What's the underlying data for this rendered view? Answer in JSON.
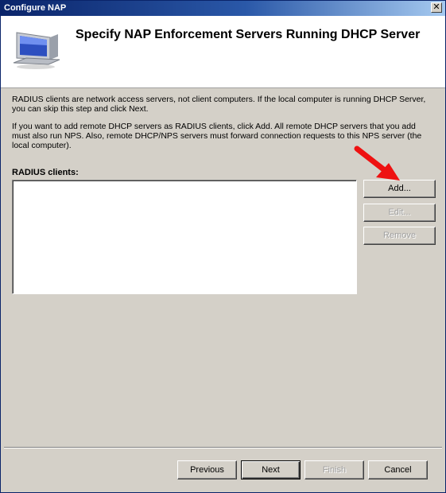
{
  "window": {
    "title": "Configure NAP",
    "close_glyph": "✕"
  },
  "header": {
    "title": "Specify NAP Enforcement Servers Running DHCP Server",
    "icon": "computer-monitor-icon"
  },
  "body": {
    "paragraph1": "RADIUS clients are network access servers, not client computers. If the local computer is running DHCP Server, you can skip this step and click Next.",
    "paragraph2": "If you want to add remote DHCP servers as RADIUS clients, click Add. All remote DHCP servers that you add must also run NPS. Also, remote DHCP/NPS servers must forward connection requests to this NPS server (the local computer).",
    "clients_label": "RADIUS clients:",
    "clients": []
  },
  "side_buttons": {
    "add": "Add...",
    "edit": "Edit...",
    "remove": "Remove"
  },
  "footer": {
    "previous": "Previous",
    "next": "Next",
    "finish": "Finish",
    "cancel": "Cancel"
  },
  "colors": {
    "titlebar": "#0a246a",
    "dialog_bg": "#d4d0c8",
    "annotation_arrow": "#ee1111"
  }
}
